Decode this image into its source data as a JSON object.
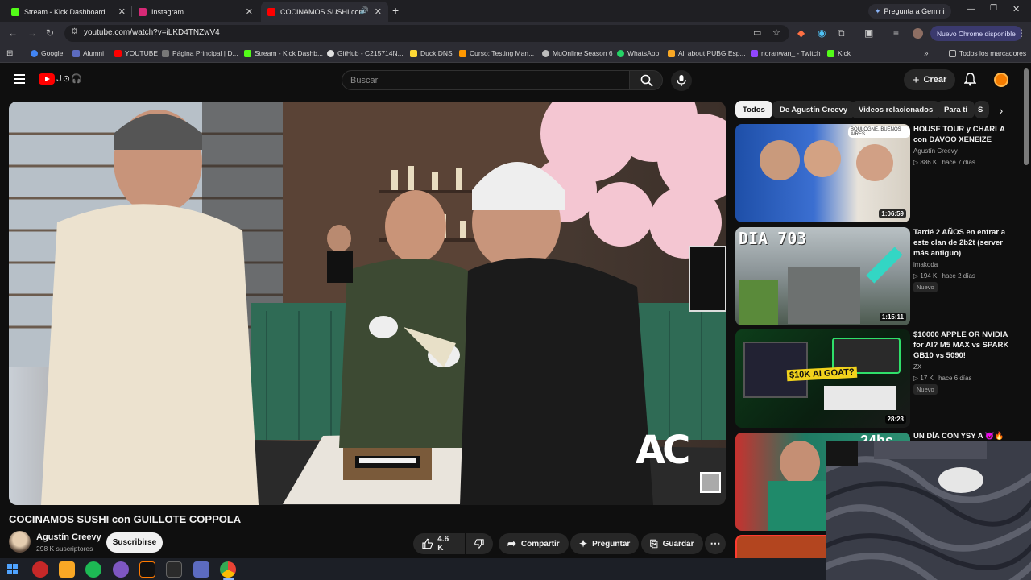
{
  "browser": {
    "tabs": [
      {
        "title": "Stream - Kick Dashboard",
        "color": "#53fc18"
      },
      {
        "title": "Instagram",
        "color": "#d62976"
      },
      {
        "title": "COCINAMOS SUSHI con GU",
        "color": "#ff0000"
      }
    ],
    "gemini_label": "Pregunta a Gemini",
    "url": "youtube.com/watch?v=iLKD4TNZwV4",
    "update_label": "Nuevo Chrome disponible",
    "bookmarks": [
      "Google",
      "Alumni",
      "YOUTUBE",
      "Página Principal | D...",
      "Stream - Kick Dashb...",
      "GitHub - C215714N...",
      "Duck DNS",
      "Curso: Testing Man...",
      "MuOnline Season 6",
      "WhatsApp",
      "All about PUBG Esp...",
      "noranwan_ - Twitch",
      "Kick"
    ],
    "all_bookmarks_label": "Todos los marcadores"
  },
  "youtube": {
    "search_placeholder": "Buscar",
    "create_label": "Crear"
  },
  "video": {
    "title": "COCINAMOS SUSHI con GUILLOTE COPPOLA",
    "channel": "Agustín Creevy",
    "subscribers": "298 K suscriptores",
    "subscribe_label": "Suscribirse",
    "likes": "4.6 K",
    "share_label": "Compartir",
    "ask_label": "Preguntar",
    "save_label": "Guardar",
    "watermark": "AC"
  },
  "chips": [
    "Todos",
    "De Agustín Creevy",
    "Videos relacionados",
    "Para ti",
    "S"
  ],
  "recommendations": [
    {
      "title": "HOUSE TOUR y CHARLA con DAVOO XENEIZE",
      "channel": "Agustín Creevy",
      "views": "886 K",
      "age": "hace 7 días",
      "duration": "1:06:59",
      "thumb_text": "BOULOGNE, BUENOS AIRES",
      "badge": ""
    },
    {
      "title": "Tardé 2 AÑOS en entrar a este clan de 2b2t (server más antiguo)",
      "channel": "imakoda",
      "views": "194 K",
      "age": "hace 2 días",
      "duration": "1:15:11",
      "thumb_text": "DIA 703",
      "badge": "Nuevo"
    },
    {
      "title": "$10000 APPLE OR NVIDIA for AI? M5 MAX vs SPARK GB10 vs 5090!",
      "channel": "ZX",
      "views": "17 K",
      "age": "hace 6 días",
      "duration": "28:23",
      "thumb_text": "$10K AI GOAT?",
      "badge": "Nuevo"
    },
    {
      "title": "UN DÍA CON YSY A 😈🔥 ASÍ",
      "channel": "",
      "views": "",
      "age": "",
      "duration": "",
      "thumb_text": "24hs",
      "badge": ""
    }
  ]
}
